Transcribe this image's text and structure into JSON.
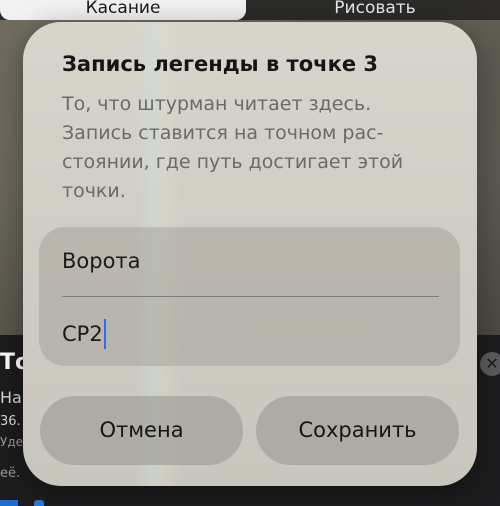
{
  "background": {
    "segmented_control": {
      "tabs": [
        {
          "label": "Касание",
          "selected": true
        },
        {
          "label": "Рисовать",
          "selected": false
        }
      ]
    },
    "bottom_card": {
      "title_fragment": "То",
      "line1_fragment": "На",
      "line2_fragment": "36.",
      "line3_fragment": "Уде",
      "line4_fragment": "её.",
      "close_glyph": "✕"
    }
  },
  "dialog": {
    "title": "Запись легенды в точке 3",
    "message": "То, что штурман читает здесь. Запись ставится на точном рас-стоянии, где путь достигает этой точки.",
    "fields": {
      "name_value": "Ворота",
      "code_value": "CP2"
    },
    "buttons": {
      "cancel_label": "Отмена",
      "save_label": "Сохранить"
    }
  },
  "colors": {
    "caret": "#2f6df5",
    "dialog_bg": "#d2cfc7",
    "card_bg": "#1c1c1e"
  }
}
